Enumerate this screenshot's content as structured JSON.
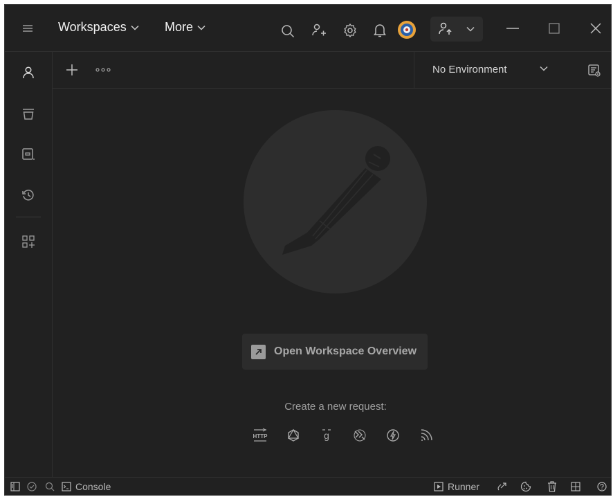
{
  "titlebar": {
    "workspaces_label": "Workspaces",
    "more_label": "More"
  },
  "tabbar": {
    "environment": "No Environment"
  },
  "main": {
    "overview_button": "Open Workspace Overview",
    "create_label": "Create a new request:",
    "request_types": [
      "http-icon",
      "graphql-icon",
      "grpc-icon",
      "websocket-icon",
      "socketio-icon",
      "mqtt-icon"
    ]
  },
  "statusbar": {
    "console_label": "Console",
    "runner_label": "Runner"
  },
  "colors": {
    "window_bg": "#212121",
    "panel_bg": "#2c2c2c",
    "logo_bg": "#2d2d2d",
    "text": "#f2f2f2",
    "muted": "#a0a0a0"
  }
}
